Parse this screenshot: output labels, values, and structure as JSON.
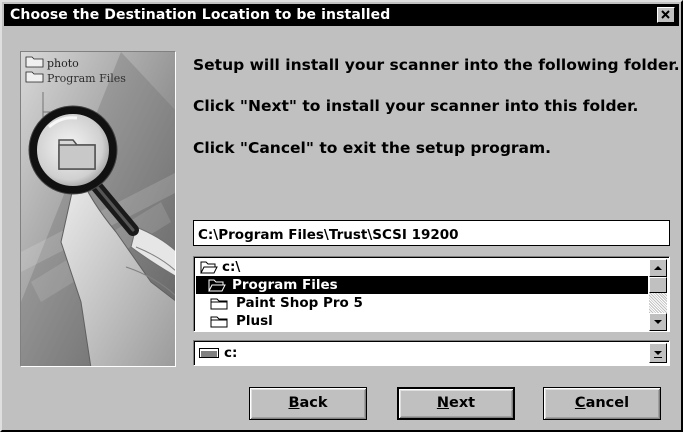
{
  "dialog": {
    "title": "Choose the Destination Location to be installed"
  },
  "illustration": {
    "folder_labels": [
      "photo",
      "Program Files"
    ]
  },
  "messages": [
    "Setup will install your scanner  into the following folder.",
    "Click \"Next\" to install your scanner into this folder.",
    "Click \"Cancel\" to exit the setup program."
  ],
  "path_field": {
    "value": "C:\\Program Files\\Trust\\SCSI 19200"
  },
  "directory_list": {
    "items": [
      {
        "label": "c:\\",
        "icon": "open-folder-icon",
        "selected": false
      },
      {
        "label": "Program Files",
        "icon": "open-folder-icon",
        "selected": true
      },
      {
        "label": "Paint Shop Pro 5",
        "icon": "folder-icon",
        "selected": false
      },
      {
        "label": "Plusl",
        "icon": "folder-icon",
        "selected": false
      }
    ]
  },
  "drive_select": {
    "value": "c:",
    "icon": "drive-icon"
  },
  "buttons": {
    "back": {
      "mnemonic": "B",
      "rest": "ack"
    },
    "next": {
      "mnemonic": "N",
      "rest": "ext"
    },
    "cancel": {
      "mnemonic": "C",
      "rest": "ancel"
    }
  },
  "colors": {
    "face": "#c0c0c0",
    "titlebar": "#000000",
    "selection": "#000000"
  }
}
